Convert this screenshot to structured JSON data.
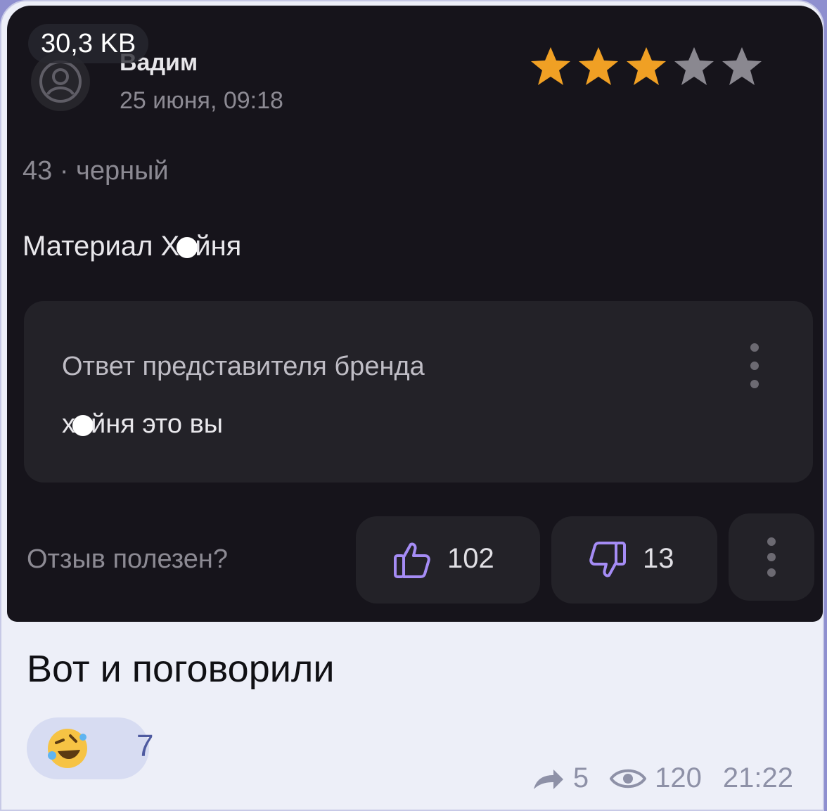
{
  "file_size": "30,3 KB",
  "review": {
    "author": "Вадим",
    "date": "25 июня, 09:18",
    "rating": 3,
    "rating_max": 5,
    "size_color": "43 · черный",
    "text_before": "Материал Х",
    "text_after": "йня",
    "reply_title": "Ответ представителя бренда",
    "reply_text_before": "х",
    "reply_text_after": "йня это вы",
    "helpful_label": "Отзыв полезен?",
    "likes": "102",
    "dislikes": "13"
  },
  "caption": "Вот и поговорили",
  "reaction": {
    "emoji_name": "rolling-on-floor-laughing-emoji",
    "count": "7"
  },
  "meta": {
    "forwards": "5",
    "views": "120",
    "time": "21:22"
  },
  "colors": {
    "star_active": "#f0a024",
    "star_inactive": "#8a8890",
    "icon_accent": "#a58cf5"
  }
}
